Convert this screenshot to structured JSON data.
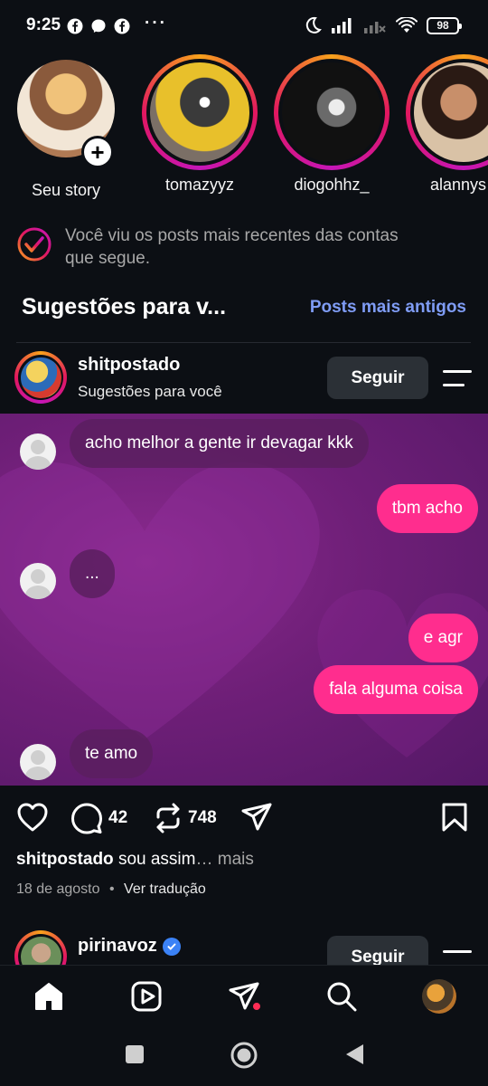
{
  "status_bar": {
    "time": "9:25",
    "dots": "···",
    "battery": "98"
  },
  "stories": [
    {
      "name": "Seu story",
      "own": true
    },
    {
      "name": "tomazyyz",
      "own": false
    },
    {
      "name": "diogohhz_",
      "own": false
    },
    {
      "name": "alannys",
      "own": false
    }
  ],
  "seen_banner": {
    "text_line1": "Você viu os posts mais recentes das contas",
    "text_line2": "que segue."
  },
  "suggestions": {
    "title": "Sugestões para v...",
    "older_link": "Posts mais antigos"
  },
  "post": {
    "username": "shitpostado",
    "subtitle": "Sugestões para você",
    "follow_label": "Seguir",
    "chat": [
      {
        "from": "them",
        "text": "acho melhor a gente ir devagar kkk"
      },
      {
        "from": "me",
        "text": "tbm acho"
      },
      {
        "from": "them",
        "text": "..."
      },
      {
        "from": "me",
        "text": "e agr"
      },
      {
        "from": "me",
        "text": "fala alguma coisa"
      },
      {
        "from": "them",
        "text": "te amo"
      }
    ],
    "comments_count": "42",
    "reposts_count": "748",
    "caption_user": "shitpostado",
    "caption_text": "sou assim",
    "caption_more": "… mais",
    "date": "18 de agosto",
    "separator": "•",
    "translate": "Ver tradução"
  },
  "next_post": {
    "username": "pirinavoz",
    "follow_label": "Seguir"
  },
  "colors": {
    "background": "#0c0f14",
    "link": "#7f9cf5",
    "outgoing_bubble": "#ff2d8e",
    "notification_dot": "#ff2d55"
  },
  "icons": {
    "like": "heart-icon",
    "comment": "comment-icon",
    "repost": "repost-icon",
    "share": "send-icon",
    "save": "bookmark-icon"
  }
}
